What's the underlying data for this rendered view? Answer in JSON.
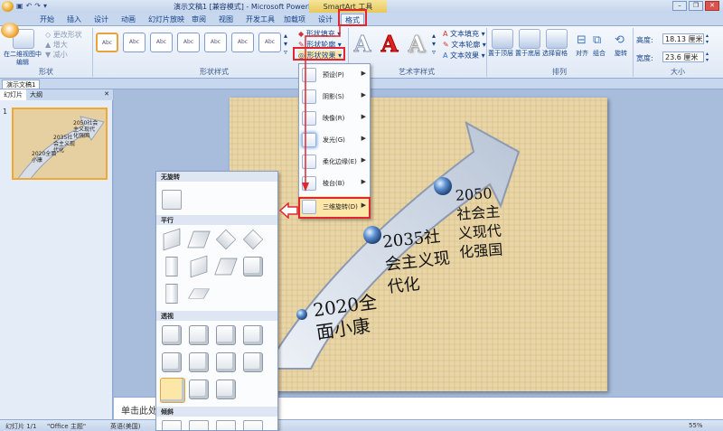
{
  "title_bar": {
    "qat_icons": [
      "save-icon",
      "undo-icon",
      "redo-icon",
      "dropdown-icon"
    ],
    "document_title": "演示文稿1 [兼容模式] - Microsoft PowerPoint",
    "contextual_group": "SmartArt 工具",
    "window_controls": [
      "minimize",
      "restore",
      "close"
    ]
  },
  "tabs": [
    "开始",
    "插入",
    "设计",
    "动画",
    "幻灯片放映",
    "审阅",
    "视图",
    "开发工具",
    "加载项",
    "设计",
    "格式"
  ],
  "active_tab": "格式",
  "ribbon": {
    "shape_group": {
      "label": "形状",
      "edit_2d": "在二维视图中编辑",
      "change_shape": "更改形状",
      "larger": "增大",
      "smaller": "减小"
    },
    "shape_styles": {
      "label": "形状样式",
      "thumb_text": "Abc",
      "fill": "形状填充",
      "outline": "形状轮廓",
      "effects": "形状效果"
    },
    "wordart": {
      "label": "艺术字样式",
      "sample": "A",
      "text_fill": "文本填充",
      "text_outline": "文本轮廓",
      "text_effects": "文本效果"
    },
    "arrange": {
      "label": "排列",
      "bring_front": "置于顶层",
      "send_back": "置于底层",
      "selection_pane": "选择窗格",
      "align": "对齐",
      "group": "组合",
      "rotate": "旋转"
    },
    "size": {
      "label": "大小",
      "height_label": "高度:",
      "height_value": "18.13 厘米",
      "width_label": "宽度:",
      "width_value": "23.6 厘米"
    }
  },
  "doc_tab": "演示文稿1",
  "pane_tabs": [
    "幻灯片",
    "大纲"
  ],
  "slide_number": "1",
  "shape_effects_menu": [
    {
      "label": "预设(P)"
    },
    {
      "label": "阴影(S)"
    },
    {
      "label": "映像(R)"
    },
    {
      "label": "发光(G)"
    },
    {
      "label": "柔化边缘(E)"
    },
    {
      "label": "棱台(B)"
    },
    {
      "label": "三维旋转(D)"
    }
  ],
  "rotation_gallery": {
    "sections": [
      "无旋转",
      "平行",
      "透视",
      "倾斜"
    ]
  },
  "slide": {
    "milestones": [
      {
        "text": "2020全面小康"
      },
      {
        "text": "2035社会主义现代化"
      },
      {
        "text": "2050社会主义现代化强国"
      }
    ]
  },
  "thumb_texts": [
    "2020全面小康",
    "2035社会主义现代化",
    "2050社会主义现代化强国"
  ],
  "notes_placeholder": "单击此处添",
  "status": {
    "slide_count": "幻灯片 1/1",
    "theme": "\"Office 主题\"",
    "language": "英语(美国)",
    "zoom": "55%"
  },
  "colors": {
    "highlight": "#e0262e",
    "ribbon": "#dfe8f5"
  }
}
